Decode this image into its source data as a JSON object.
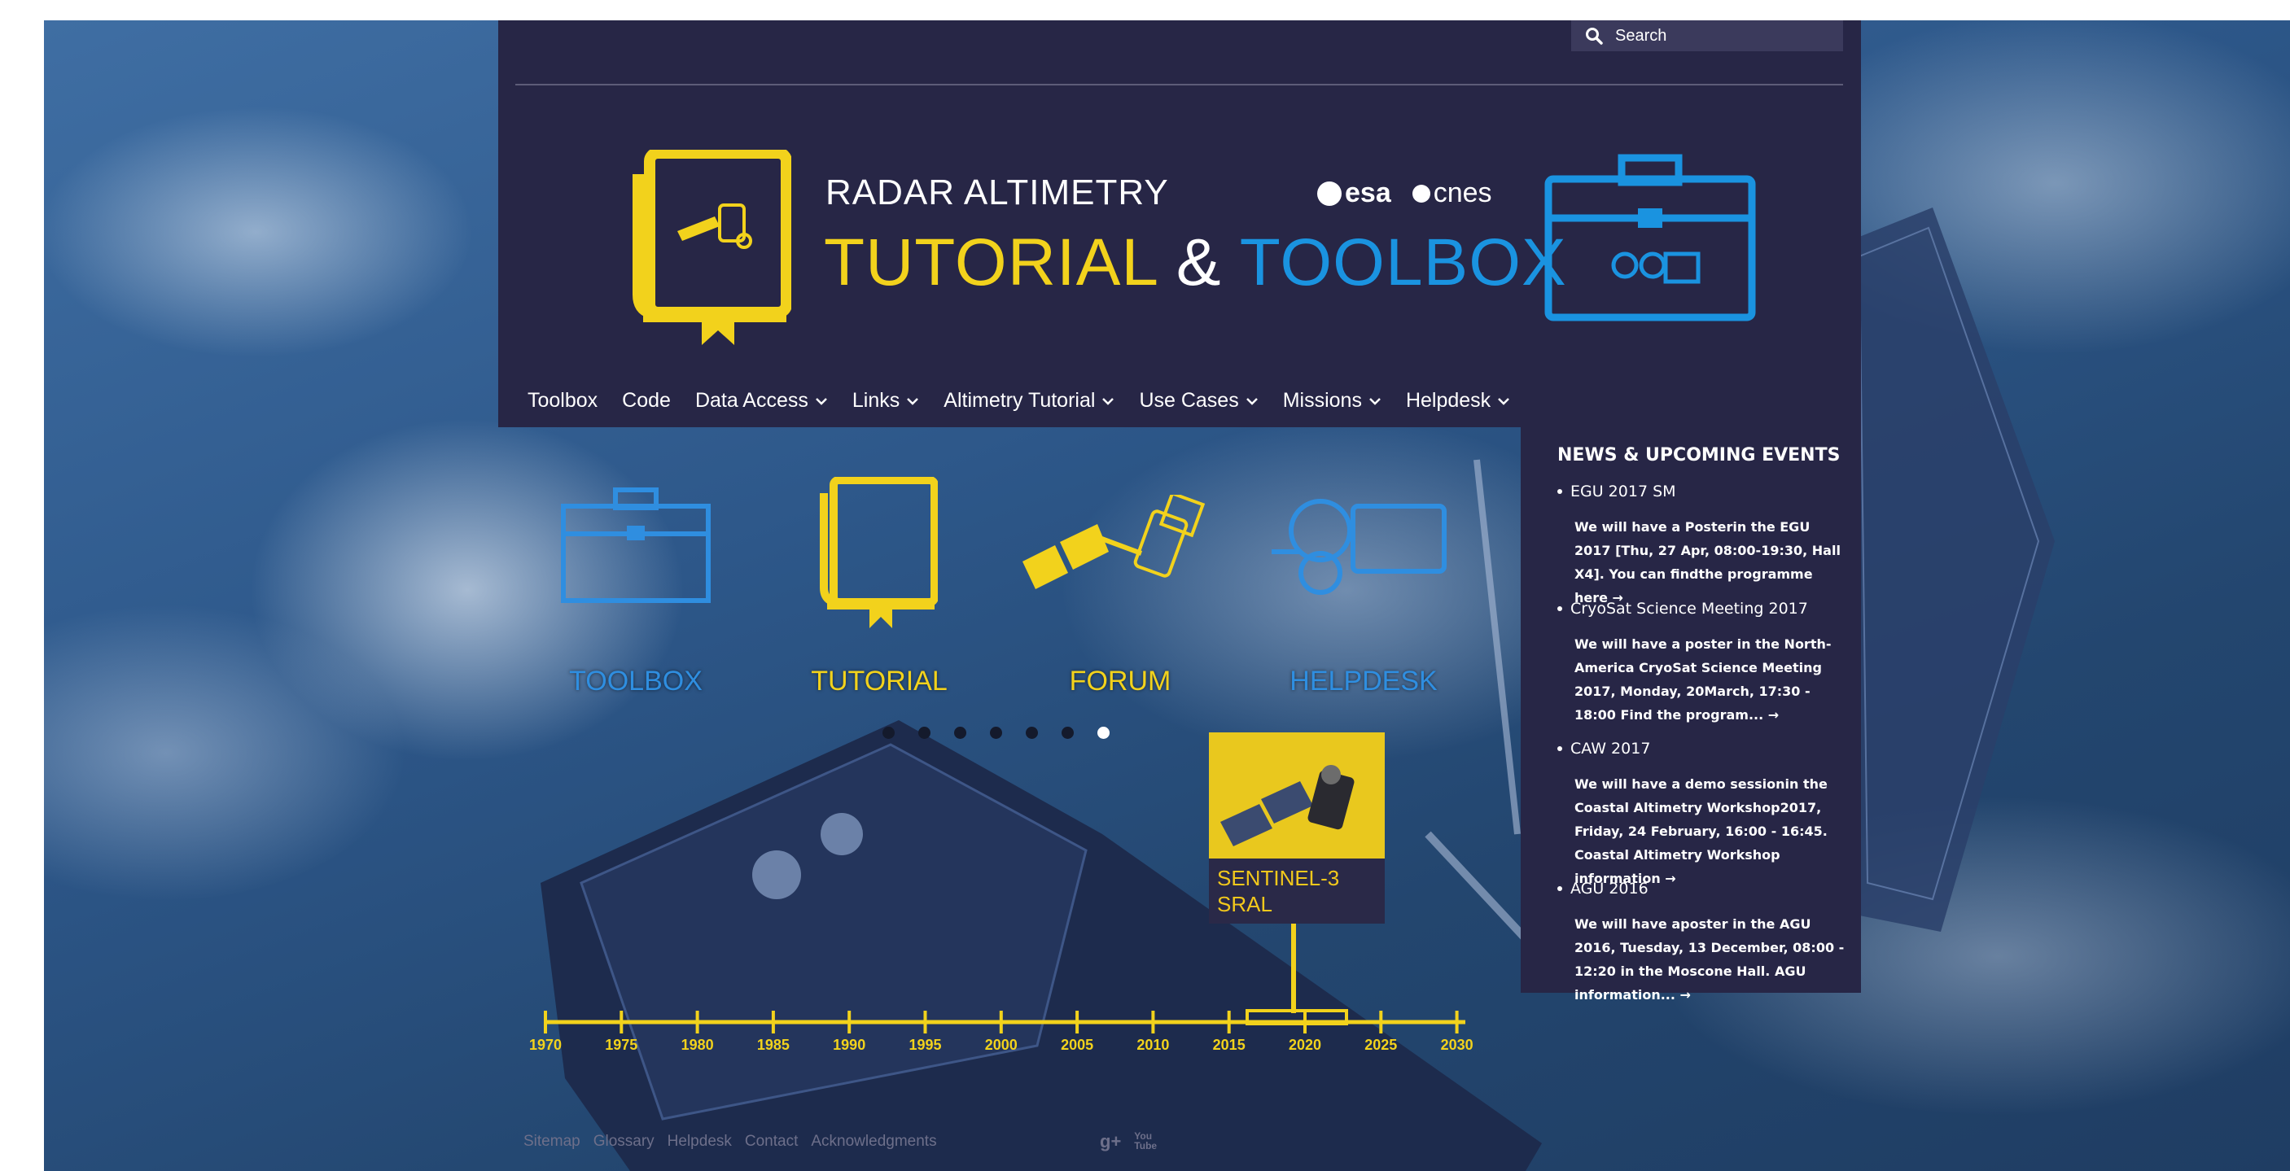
{
  "search": {
    "placeholder": "Search"
  },
  "header": {
    "title_small": "RADAR ALTIMETRY",
    "title_part1": "TUTORIAL",
    "title_amp": "&",
    "title_part2": "TOOLBOX",
    "partners": [
      "esa",
      "cnes"
    ]
  },
  "nav": [
    {
      "label": "Toolbox",
      "dropdown": false
    },
    {
      "label": "Code",
      "dropdown": false
    },
    {
      "label": "Data Access",
      "dropdown": true
    },
    {
      "label": "Links",
      "dropdown": true
    },
    {
      "label": "Altimetry Tutorial",
      "dropdown": true
    },
    {
      "label": "Use Cases",
      "dropdown": true
    },
    {
      "label": "Missions",
      "dropdown": true
    },
    {
      "label": "Helpdesk",
      "dropdown": true
    }
  ],
  "hero": {
    "toolbox": "TOOLBOX",
    "tutorial": "TUTORIAL",
    "forum": "FORUM",
    "helpdesk": "HELPDESK"
  },
  "slider": {
    "dot_count": 7,
    "active_index": 6
  },
  "card": {
    "title_line1": "SENTINEL-3",
    "title_line2": "SRAL"
  },
  "timeline": {
    "years": [
      "1970",
      "1975",
      "1980",
      "1985",
      "1990",
      "1995",
      "2000",
      "2005",
      "2010",
      "2015",
      "2020",
      "2025",
      "2030"
    ]
  },
  "news": {
    "title": "NEWS & UPCOMING EVENTS",
    "items": [
      {
        "head": "EGU 2017 SM",
        "body": "We will have a Posterin the EGU 2017 [Thu, 27 Apr, 08:00-19:30, Hall X4]. You can findthe programme here →"
      },
      {
        "head": "CryoSat Science Meeting 2017",
        "body": "We will have a poster in the North-America CryoSat Science Meeting 2017, Monday, 20March, 17:30 - 18:00 Find the program... →"
      },
      {
        "head": "CAW 2017",
        "body": "We will have a demo sessionin the Coastal Altimetry Workshop2017, Friday, 24 February, 16:00 - 16:45. Coastal Altimetry Workshop information →"
      },
      {
        "head": "AGU 2016",
        "body": "We will have aposter in the AGU 2016, Tuesday, 13 December, 08:00 - 12:20 in the Moscone Hall. AGU information... →"
      }
    ]
  },
  "footer": {
    "links": [
      "Sitemap",
      "Glossary",
      "Helpdesk",
      "Contact",
      "Acknowledgments"
    ],
    "social": [
      "g+",
      "You Tube"
    ]
  },
  "colors": {
    "panel": "#272646",
    "yellow": "#f2d21c",
    "blue": "#1a93e0"
  }
}
